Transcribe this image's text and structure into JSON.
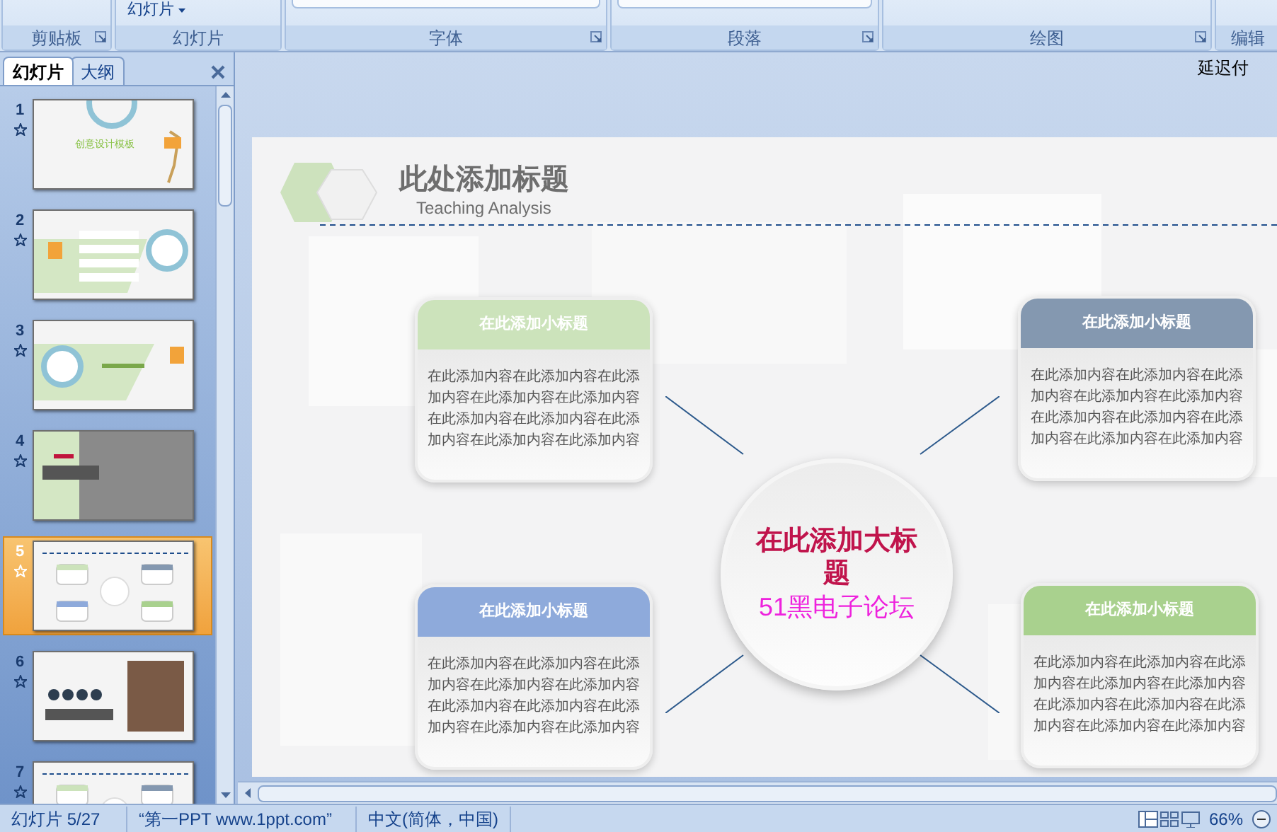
{
  "ribbon": {
    "slide_button": "幻灯片",
    "groups": [
      {
        "label": "剪贴板",
        "launcher": true
      },
      {
        "label": "幻灯片",
        "launcher": false
      },
      {
        "label": "字体",
        "launcher": true
      },
      {
        "label": "段落",
        "launcher": true
      },
      {
        "label": "绘图",
        "launcher": true
      },
      {
        "label": "编辑",
        "launcher": false
      }
    ]
  },
  "pane": {
    "tabs": [
      {
        "label": "幻灯片",
        "selected": true
      },
      {
        "label": "大纲",
        "selected": false
      }
    ],
    "slides": [
      {
        "number": "1",
        "selected": false,
        "kind": "title",
        "title": "创意设计模板"
      },
      {
        "number": "2",
        "selected": false,
        "kind": "list"
      },
      {
        "number": "3",
        "selected": false,
        "kind": "band"
      },
      {
        "number": "4",
        "selected": false,
        "kind": "photo"
      },
      {
        "number": "5",
        "selected": true,
        "kind": "diagram"
      },
      {
        "number": "6",
        "selected": false,
        "kind": "portrait"
      },
      {
        "number": "7",
        "selected": false,
        "kind": "diagram"
      }
    ]
  },
  "note": "延迟付",
  "slide": {
    "title": "此处添加标题",
    "subtitle": "Teaching Analysis",
    "cards": [
      {
        "heading": "在此添加小标题",
        "body": "在此添加内容在此添加内容在此添加内容在此添加内容在此添加内容在此添加内容在此添加内容在此添加内容在此添加内容在此添加内容",
        "color": "#cce3bb"
      },
      {
        "heading": "在此添加小标题",
        "body": "在此添加内容在此添加内容在此添加内容在此添加内容在此添加内容在此添加内容在此添加内容在此添加内容在此添加内容在此添加内容",
        "color": "#8498b0"
      },
      {
        "heading": "在此添加小标题",
        "body": "在此添加内容在此添加内容在此添加内容在此添加内容在此添加内容在此添加内容在此添加内容在此添加内容在此添加内容在此添加内容",
        "color": "#8eaadb"
      },
      {
        "heading": "在此添加小标题",
        "body": "在此添加内容在此添加内容在此添加内容在此添加内容在此添加内容在此添加内容在此添加内容在此添加内容在此添加内容在此添加内容",
        "color": "#a9d18e"
      }
    ],
    "center": {
      "title": "在此添加大标题",
      "subtitle": "51黑电子论坛"
    }
  },
  "status_bar": {
    "slide": "幻灯片 5/27",
    "theme": "“第一PPT www.1ppt.com”",
    "language": "中文(简体，中国)",
    "zoom": "66%"
  }
}
